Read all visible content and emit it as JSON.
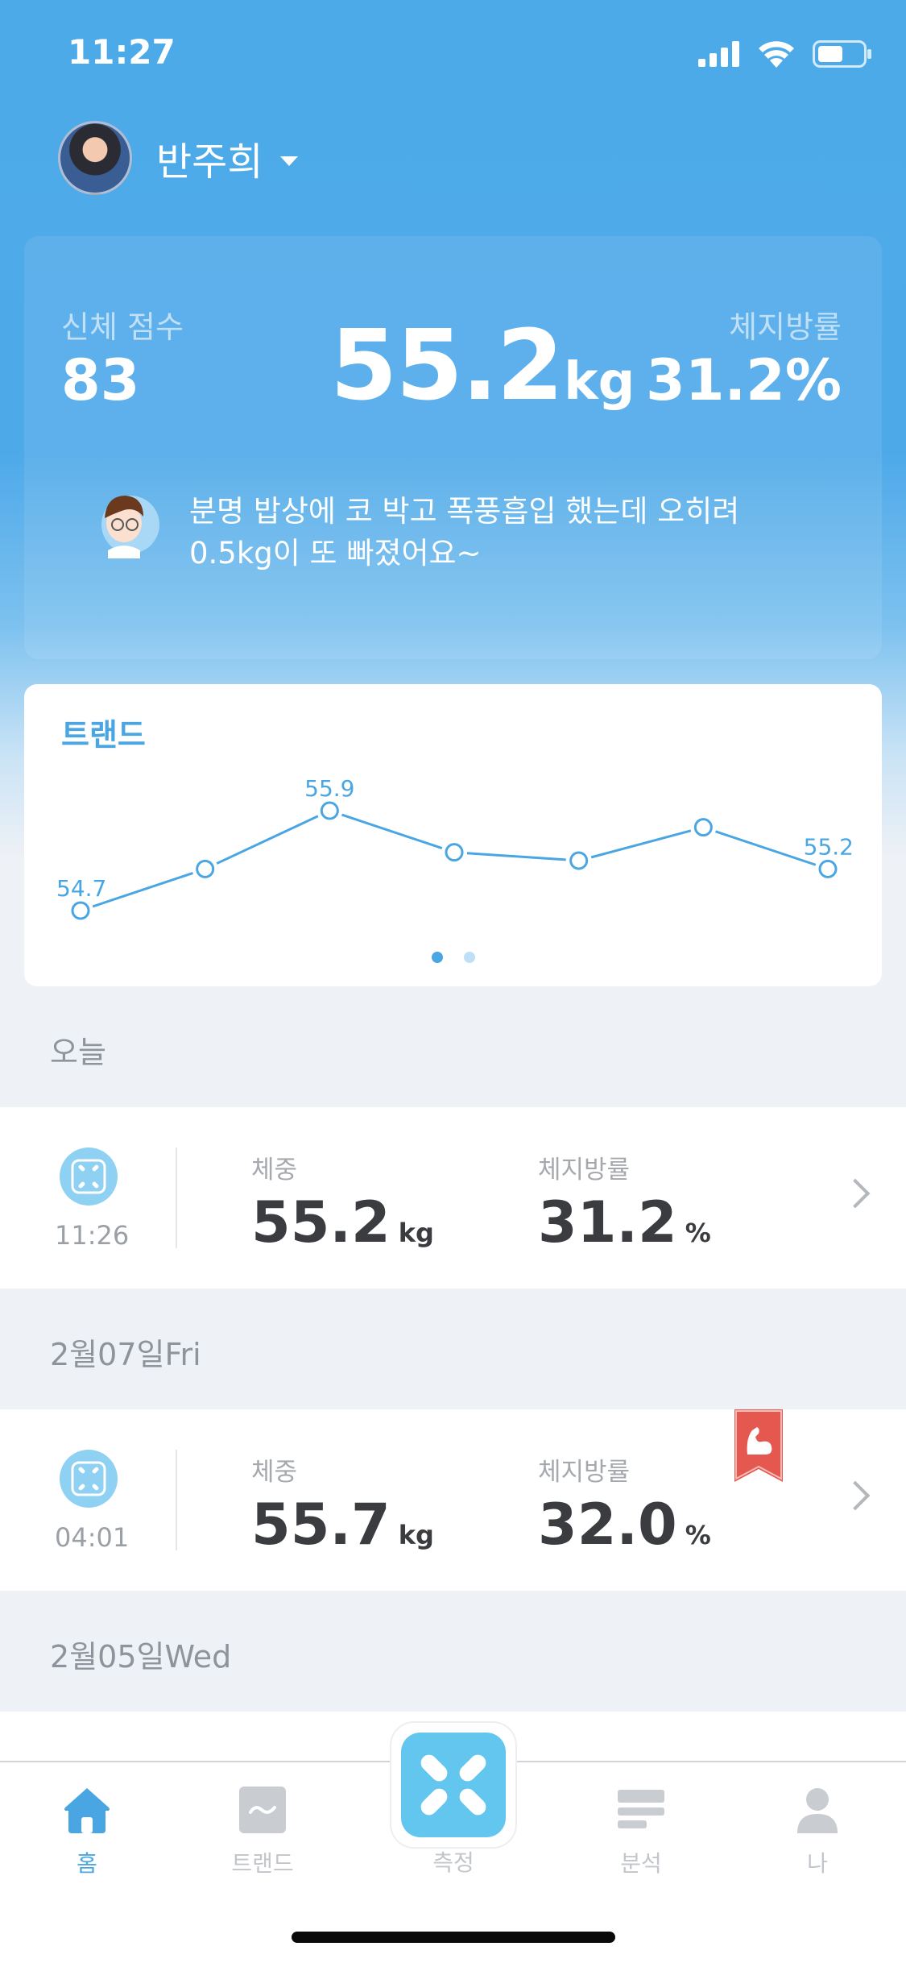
{
  "status_bar": {
    "time": "11:27"
  },
  "header": {
    "user_name": "반주희"
  },
  "summary": {
    "score_label": "신체 점수",
    "score_value": "83",
    "weight_value": "55.2",
    "weight_unit": "kg",
    "fat_label": "체지방률",
    "fat_value": "31.2%",
    "message_line1": "분명 밥상에 코 박고 폭풍흡입 했는데 오히려",
    "message_line2": "0.5kg이 또 빠졌어요~"
  },
  "trend": {
    "title": "트랜드",
    "pages": 2,
    "active_page": 0
  },
  "chart_data": {
    "type": "line",
    "series": [
      {
        "values": [
          54.7,
          55.2,
          55.9,
          55.4,
          55.3,
          55.7,
          55.2
        ]
      }
    ],
    "point_labels": [
      "54.7",
      "",
      "55.9",
      "",
      "",
      "",
      "55.2"
    ]
  },
  "sections": [
    {
      "label": "오늘",
      "record": {
        "time": "11:26",
        "weight_label": "체중",
        "weight": "55.2",
        "weight_unit": "kg",
        "fat_label": "체지방률",
        "fat": "31.2",
        "fat_unit": "%"
      }
    },
    {
      "label": "2월07일Fri",
      "record": {
        "time": "04:01",
        "weight_label": "체중",
        "weight": "55.7",
        "weight_unit": "kg",
        "fat_label": "체지방률",
        "fat": "32.0",
        "fat_unit": "%"
      }
    },
    {
      "label": "2월05일Wed"
    }
  ],
  "tabs": [
    {
      "label": "홈",
      "icon": "home-icon",
      "active": true
    },
    {
      "label": "트랜드",
      "icon": "trend-icon"
    },
    {
      "label": "측정",
      "icon": "scale-icon"
    },
    {
      "label": "분석",
      "icon": "analysis-icon"
    },
    {
      "label": "나",
      "icon": "profile-icon"
    }
  ],
  "colors": {
    "accent": "#4aa6e3",
    "header_blue": "#4daae8",
    "badge_red": "#e4584f"
  }
}
